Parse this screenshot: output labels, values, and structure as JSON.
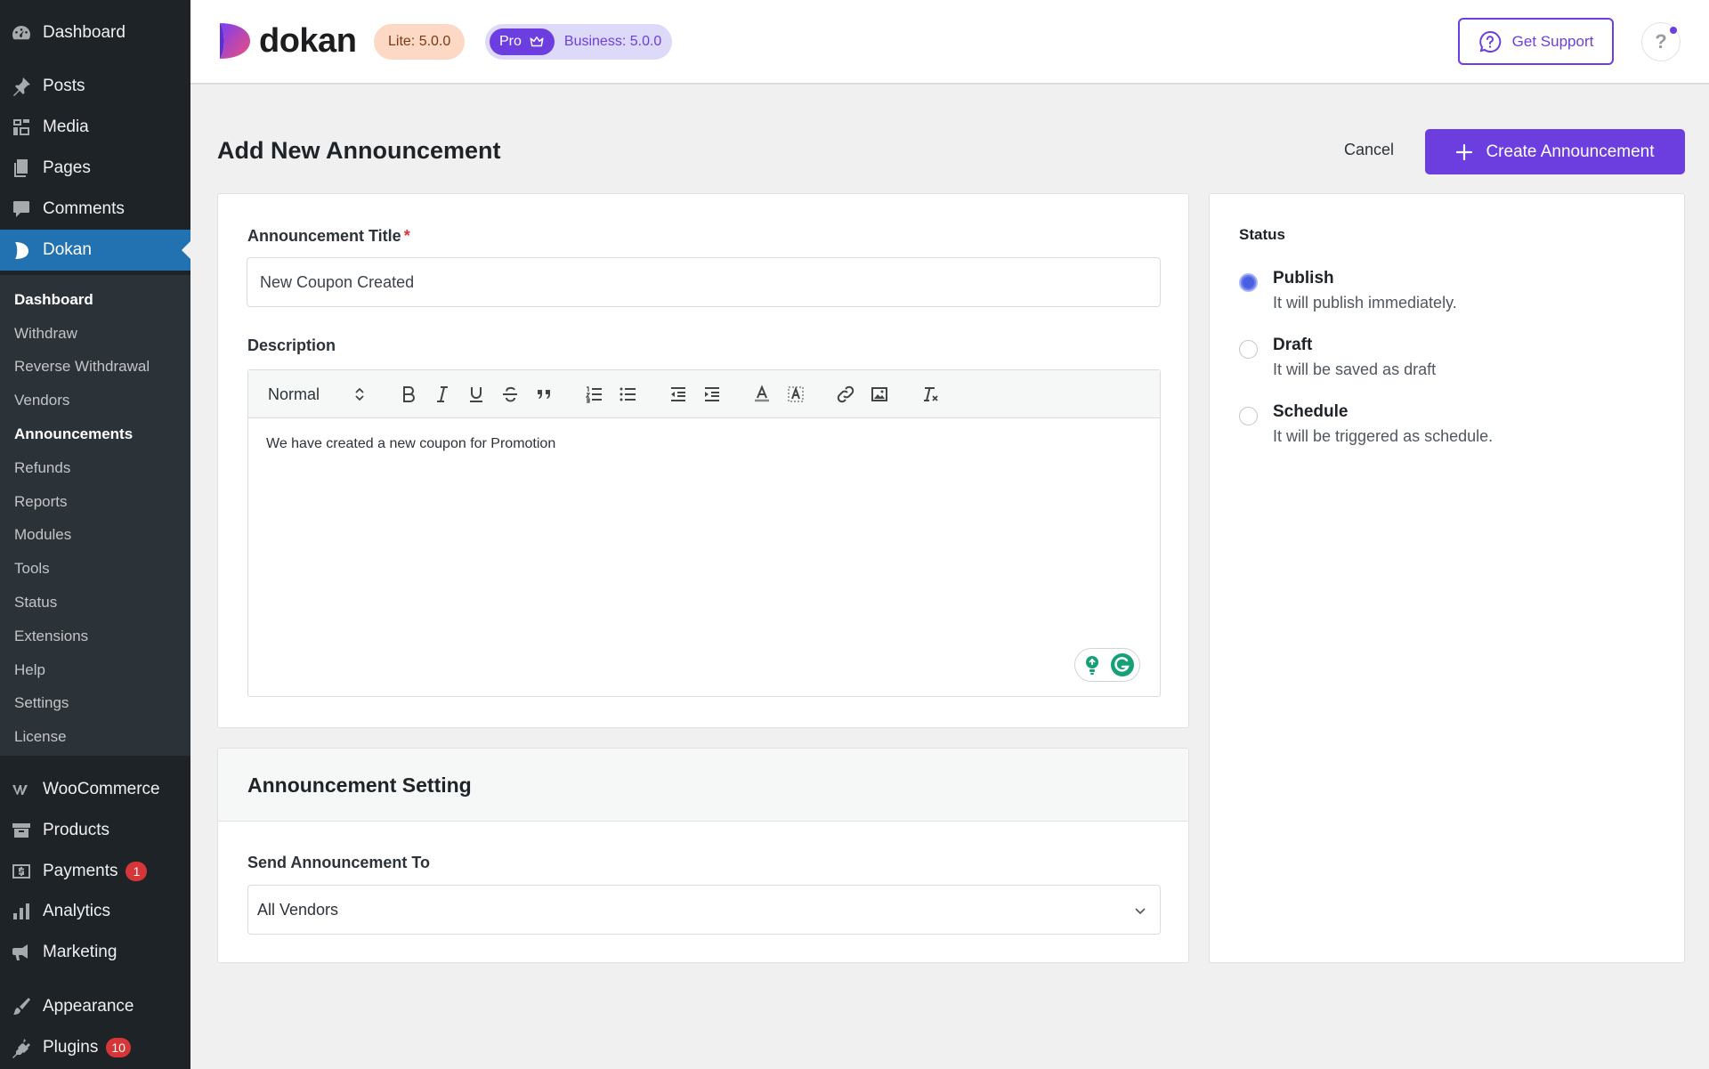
{
  "sidebar": {
    "top_items": [
      {
        "label": "Dashboard",
        "icon": "gauge-icon"
      },
      {
        "label": "Posts",
        "icon": "pin-icon"
      },
      {
        "label": "Media",
        "icon": "media-icon"
      },
      {
        "label": "Pages",
        "icon": "pages-icon"
      },
      {
        "label": "Comments",
        "icon": "comment-icon"
      },
      {
        "label": "Dokan",
        "icon": "dokan-icon",
        "active": true
      }
    ],
    "submenu": [
      "Dashboard",
      "Withdraw",
      "Reverse Withdrawal",
      "Vendors",
      "Announcements",
      "Refunds",
      "Reports",
      "Modules",
      "Tools",
      "Status",
      "Extensions",
      "Help",
      "Settings",
      "License"
    ],
    "bottom_items": [
      {
        "label": "WooCommerce",
        "icon": "woo-icon"
      },
      {
        "label": "Products",
        "icon": "archive-icon"
      },
      {
        "label": "Payments",
        "icon": "payment-icon",
        "badge": "1"
      },
      {
        "label": "Analytics",
        "icon": "bar-chart-icon"
      },
      {
        "label": "Marketing",
        "icon": "megaphone-icon"
      },
      {
        "label": "Appearance",
        "icon": "brush-icon"
      },
      {
        "label": "Plugins",
        "icon": "plug-icon",
        "badge": "10"
      }
    ]
  },
  "header": {
    "logo_text": "dokan",
    "lite_badge": "Lite: 5.0.0",
    "pro_label": "Pro",
    "business_label": "Business: 5.0.0",
    "support_label": "Get Support",
    "help_label": "?"
  },
  "page": {
    "title": "Add New Announcement",
    "cancel_label": "Cancel",
    "create_label": "Create Announcement"
  },
  "form": {
    "title_label": "Announcement Title",
    "required_mark": "*",
    "title_value": "New Coupon Created",
    "description_label": "Description",
    "editor_format": "Normal",
    "editor_text": "We have created a new coupon for Promotion"
  },
  "setting": {
    "heading": "Announcement Setting",
    "send_to_label": "Send Announcement To",
    "send_to_value": "All Vendors"
  },
  "status": {
    "label": "Status",
    "options": [
      {
        "title": "Publish",
        "description": "It will publish immediately.",
        "selected": true
      },
      {
        "title": "Draft",
        "description": "It will be saved as draft",
        "selected": false
      },
      {
        "title": "Schedule",
        "description": "It will be triggered as schedule.",
        "selected": false
      }
    ]
  },
  "colors": {
    "brand": "#6c3ee0",
    "sidebar_bg": "#1d2327",
    "sidebar_active": "#2271b1",
    "badge_red": "#d63638"
  }
}
